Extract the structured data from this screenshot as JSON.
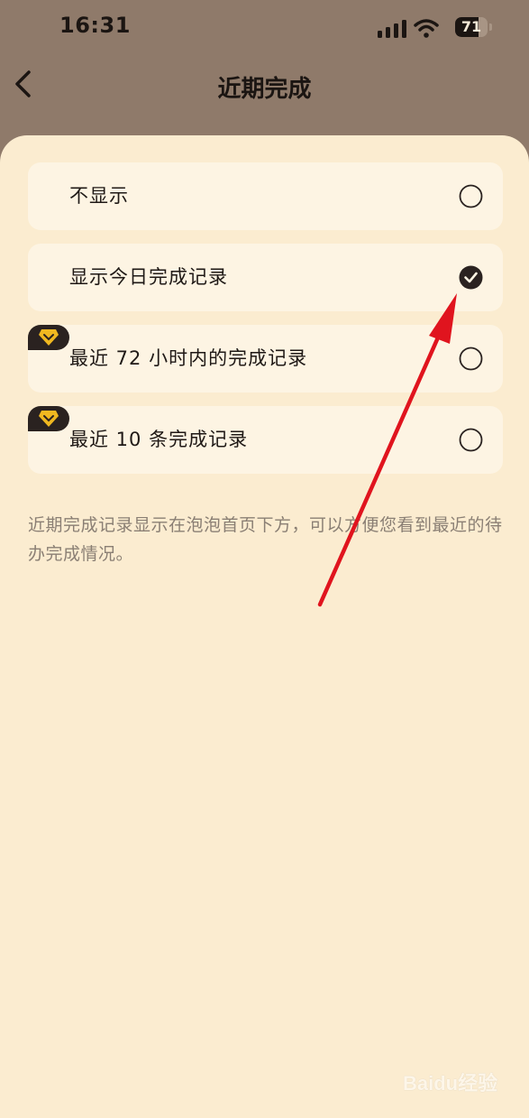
{
  "status_bar": {
    "time": "16:31",
    "battery_level": "71",
    "battery_percent": 71,
    "icons": [
      "signal-icon",
      "wifi-icon",
      "battery-icon"
    ]
  },
  "header": {
    "title": "近期完成",
    "back_icon": "chevron-left-icon"
  },
  "options": [
    {
      "label": "不显示",
      "selected": false,
      "vip": false
    },
    {
      "label": "显示今日完成记录",
      "selected": true,
      "vip": false
    },
    {
      "label": "最近 72 小时内的完成记录",
      "selected": false,
      "vip": true
    },
    {
      "label": "最近 10 条完成记录",
      "selected": false,
      "vip": true
    }
  ],
  "hint": "近期完成记录显示在泡泡首页下方，可以方便您看到最近的待办完成情况。",
  "colors": {
    "header_bg": "#8f7a6a",
    "sheet_bg": "#fbecd0",
    "card_bg": "#fdf4e3",
    "accent_dark": "#2a2220",
    "vip_gold": "#f0b820",
    "annotation_red": "#e0141e"
  },
  "watermark": "Baidu经验"
}
